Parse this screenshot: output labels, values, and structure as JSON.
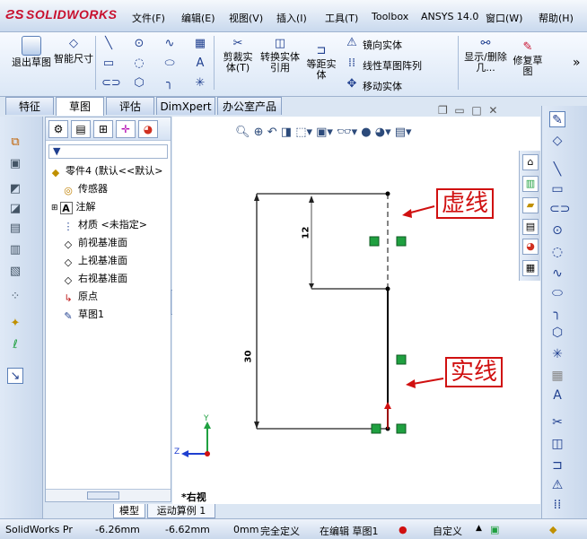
{
  "app": {
    "logo": "SOLIDWORKS"
  },
  "menu": [
    "文件(F)",
    "编辑(E)",
    "视图(V)",
    "插入(I)",
    "工具(T)",
    "Toolbox",
    "ANSYS 14.0",
    "窗口(W)",
    "帮助(H)"
  ],
  "ribbon": {
    "exit_sketch": "退出草图",
    "smart_dim": "智能尺寸",
    "trim": "剪裁实体(T)",
    "convert": "转换实体引用",
    "offset": "等距实体",
    "mirror": "镜向实体",
    "linear_pattern": "线性草图阵列",
    "move": "移动实体",
    "display_delete": "显示/删除几...",
    "repair": "修复草图"
  },
  "tabs": [
    "特征",
    "草图",
    "评估",
    "DimXpert",
    "办公室产品"
  ],
  "active_tab": "草图",
  "tree": {
    "part": "零件4 (默认<<默认>",
    "items": [
      "传感器",
      "注解",
      "材质 <未指定>",
      "前视基准面",
      "上视基准面",
      "右视基准面",
      "原点",
      "草图1"
    ]
  },
  "sketch": {
    "dim_vertical_small": "12",
    "dim_vertical_large": "30",
    "view_label": "*右视",
    "axis_y": "Y",
    "axis_z": "Z"
  },
  "annotations": {
    "dashed": "虚线",
    "solid": "实线"
  },
  "bottom_tabs": [
    "模型",
    "运动算例 1"
  ],
  "status": {
    "app": "SolidWorks Pr",
    "x": "-6.26mm",
    "y": "-6.62mm",
    "z": "0mm",
    "define": "完全定义",
    "editing": "在编辑 草图1",
    "custom": "自定义"
  },
  "colors": {
    "annotation": "#d01010",
    "relation": "#1fa040",
    "logo": "#c8102e"
  }
}
